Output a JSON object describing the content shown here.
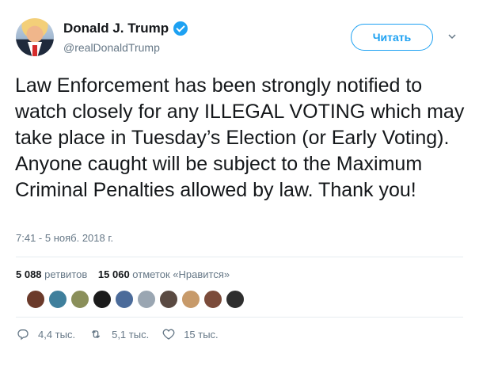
{
  "author": {
    "name": "Donald J. Trump",
    "handle": "@realDonaldTrump",
    "verified": true
  },
  "follow_button": {
    "label": "Читать"
  },
  "tweet": {
    "text": "Law Enforcement has been strongly notified to watch closely for any ILLEGAL VOTING which may take place in Tuesday’s Election (or Early Voting). Anyone caught will be subject to the Maximum Criminal Penalties allowed by law. Thank you!",
    "timestamp": "7:41 - 5 нояб. 2018 г."
  },
  "stats": {
    "retweets_count": "5 088",
    "retweets_label": "ретвитов",
    "likes_count": "15 060",
    "likes_label": "отметок «Нравится»"
  },
  "likers": [
    {
      "color": "#6b3a2a"
    },
    {
      "color": "#3f7f9c"
    },
    {
      "color": "#8a8f5a"
    },
    {
      "color": "#1b1b1b"
    },
    {
      "color": "#4b6b9a"
    },
    {
      "color": "#9aa6b2"
    },
    {
      "color": "#5a4a42"
    },
    {
      "color": "#c79a6a"
    },
    {
      "color": "#7b4b3a"
    },
    {
      "color": "#2e2e2e"
    }
  ],
  "actions": {
    "reply_count": "4,4 тыс.",
    "retweet_count": "5,1 тыс.",
    "like_count": "15 тыс."
  },
  "icons": {
    "verified": "verified-badge-icon",
    "caret": "chevron-down-icon",
    "reply": "reply-icon",
    "retweet": "retweet-icon",
    "like": "heart-icon"
  },
  "colors": {
    "accent": "#1da1f2",
    "muted": "#657786"
  }
}
